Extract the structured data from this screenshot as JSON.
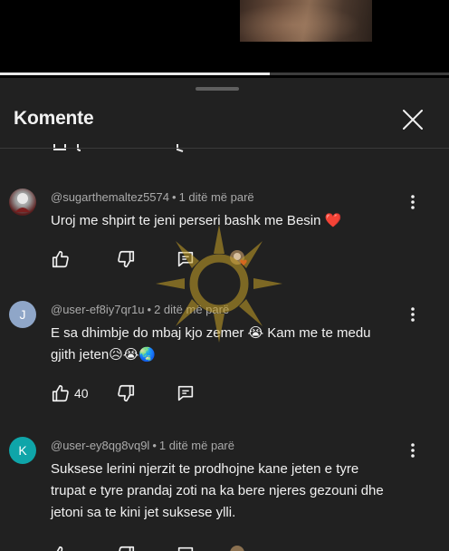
{
  "video": {
    "progress_fraction": 0.6
  },
  "sheet": {
    "title": "Komente",
    "close_icon": "close-icon"
  },
  "comments": [
    {
      "username": "@sugarthemaltez5574",
      "time": "1 ditë më parë",
      "text": "Uroj me shpirt te jeni perseri bashk me Besin ❤️",
      "avatar": {
        "type": "photo"
      },
      "likes": "",
      "creator_heart": true
    },
    {
      "username": "@user-ef8iy7qr1u",
      "time": "2 ditë më parë",
      "text": "E sa dhimbje do mbaj kjo zemer 😭 Kam me te medu gjith jeten😥😭🌏",
      "avatar": {
        "type": "letter",
        "letter": "J",
        "color": "#8fa6c8"
      },
      "likes": "40",
      "creator_heart": false
    },
    {
      "username": "@user-ey8qg8vq9l",
      "time": "1 ditë më parë",
      "text": "Suksese lerini njerzit te prodhojne kane jeten e tyre trupat e tyre prandaj zoti na ka bere njeres gezouni dhe jetoni sa te kini jet suksese ylli.",
      "avatar": {
        "type": "letter",
        "letter": "K",
        "color": "#0fa5a9"
      },
      "likes": "",
      "creator_heart": false
    }
  ],
  "meta_separator": "•",
  "colors": {
    "sheet_bg": "#212121",
    "page_bg": "#0f0f0f",
    "text_primary": "#f1f1f1",
    "text_secondary": "#aaaaaa",
    "heart": "#e62117"
  }
}
